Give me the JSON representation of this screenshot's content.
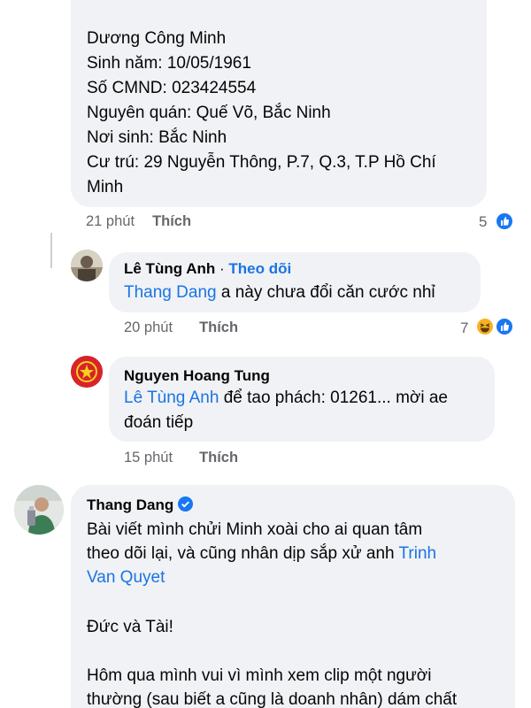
{
  "comment1": {
    "lines": [
      "Dương Công Minh",
      "Sinh năm: 10/05/1961",
      "Số CMND: 023424554",
      "Nguyên quán: Quế Võ, Bắc Ninh",
      "Nơi sinh: Bắc Ninh",
      "Cư trú: 29 Nguyễn Thông, P.7, Q.3, T.P Hồ Chí",
      "Minh"
    ],
    "time": "21 phút",
    "like_label": "Thích",
    "reaction_count": "5",
    "reactions": [
      "like-icon"
    ]
  },
  "reply1": {
    "author": "Lê Tùng Anh",
    "separator": " · ",
    "follow_label": "Theo dõi",
    "mention": "Thang Dang",
    "text": " a này chưa đổi căn cước nhỉ",
    "time": "20 phút",
    "like_label": "Thích",
    "reaction_count": "7",
    "reactions": [
      "haha-icon",
      "like-icon"
    ]
  },
  "reply2": {
    "author": "Nguyen Hoang Tung",
    "mention": "Lê Tùng Anh",
    "text_line1": " để tao phách: 01261... mời ae",
    "text_line2": "đoán tiếp",
    "time": "15 phút",
    "like_label": "Thích"
  },
  "comment2": {
    "author": "Thang Dang",
    "verified_icon": "verified-badge-icon",
    "line1": "Bài viết mình chửi Minh xoài cho ai quan tâm",
    "line2_prefix": "theo dõi lại, và cũng nhân dịp sắp xử anh ",
    "mention_part1": "Trinh",
    "mention_part2": "Van Quyet",
    "paragraph2": "Đức và Tài!",
    "paragraph3_line1": "Hôm qua mình vui vì mình xem clip một người",
    "paragraph3_line2": "thường (sau biết a cũng là doanh nhân) dám chất"
  },
  "colors": {
    "bubble": "#f0f2f5",
    "link": "#1b74e4",
    "meta": "#65676b",
    "like_blue": "#1877f2",
    "haha_yellow": "#f7b125"
  }
}
